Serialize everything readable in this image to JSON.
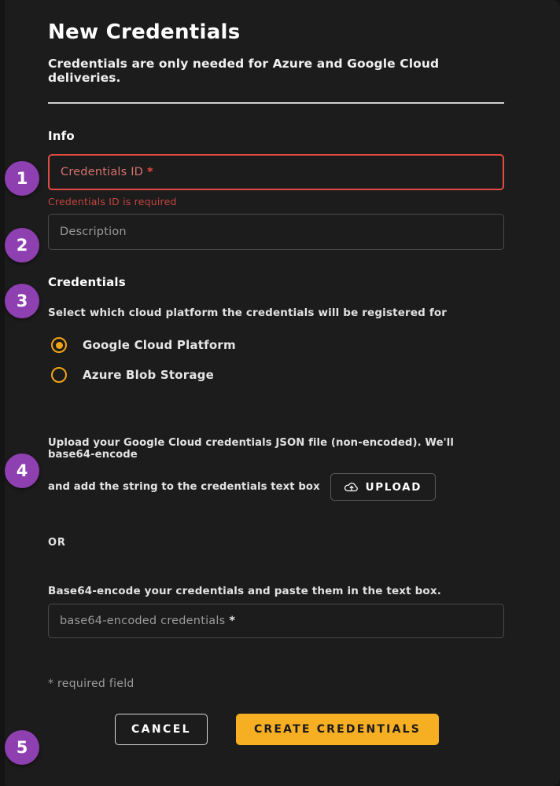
{
  "header": {
    "title": "New Credentials",
    "subtitle": "Credentials are only needed for Azure and Google Cloud deliveries."
  },
  "info_section": {
    "label": "Info",
    "credentials_id": {
      "placeholder": "Credentials ID",
      "required_marker": "*",
      "error": "Credentials ID is required"
    },
    "description": {
      "placeholder": "Description"
    }
  },
  "credentials_section": {
    "label": "Credentials",
    "instruction": "Select which cloud platform the credentials will be registered for",
    "options": [
      {
        "label": "Google Cloud Platform",
        "selected": true
      },
      {
        "label": "Azure Blob Storage",
        "selected": false
      }
    ]
  },
  "upload_section": {
    "line1": "Upload your Google Cloud credentials JSON file (non-encoded). We'll base64-encode",
    "line2": "and add the string to the credentials text box",
    "upload_button": "UPLOAD",
    "upload_icon": "cloud-upload-icon",
    "or": "OR"
  },
  "base64_section": {
    "label": "Base64-encode your credentials and paste them in the text box.",
    "placeholder": "base64-encoded credentials",
    "required_marker": "*"
  },
  "footer": {
    "required_note": "*  required field",
    "cancel_label": "CANCEL",
    "create_label": "CREATE CREDENTIALS"
  },
  "steps": [
    {
      "number": "1"
    },
    {
      "number": "2"
    },
    {
      "number": "3"
    },
    {
      "number": "4"
    },
    {
      "number": "5"
    }
  ],
  "colors": {
    "background": "#1c1c1c",
    "badge_purple": "#8e3fb0",
    "accent_amber": "#f6ae23",
    "error_red": "#e24b43",
    "border_gray": "#4a4a4a"
  }
}
